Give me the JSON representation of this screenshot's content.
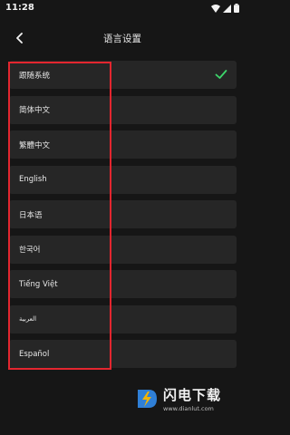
{
  "status_bar": {
    "time": "11:28",
    "icons": [
      "wifi-icon",
      "signal-icon",
      "battery-icon"
    ]
  },
  "header": {
    "back_icon": "chevron-left-icon",
    "title": "语言设置"
  },
  "languages": [
    {
      "label": "跟随系统",
      "selected": true
    },
    {
      "label": "简体中文",
      "selected": false
    },
    {
      "label": "繁體中文",
      "selected": false
    },
    {
      "label": "English",
      "selected": false
    },
    {
      "label": "日本语",
      "selected": false
    },
    {
      "label": "한국어",
      "selected": false
    },
    {
      "label": "Tiếng Việt",
      "selected": false
    },
    {
      "label": "العربية",
      "selected": false
    },
    {
      "label": "Español",
      "selected": false
    }
  ],
  "watermark": {
    "brand": "闪电下载",
    "url": "www.dianlut.com"
  },
  "colors": {
    "background": "#161616",
    "item_background": "#262626",
    "check": "#3dd66b",
    "highlight_box": "#e3262f"
  }
}
